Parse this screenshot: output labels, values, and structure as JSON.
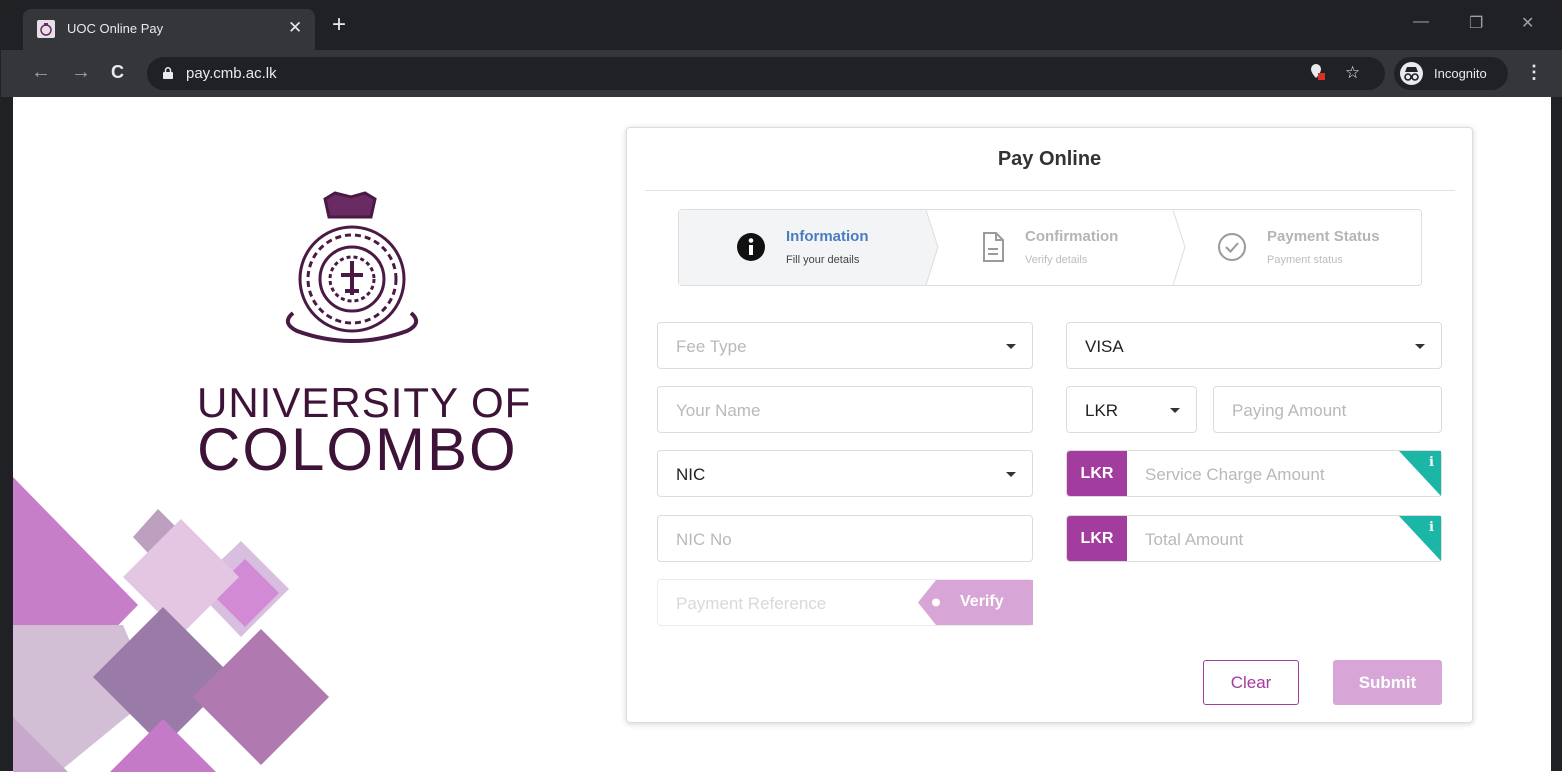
{
  "browser": {
    "tab_title": "UOC Online Pay",
    "tab_close": "✕",
    "new_tab": "+",
    "url": "pay.cmb.ac.lk",
    "incognito_label": "Incognito",
    "win_minimize": "—",
    "win_restore": "❐",
    "win_close": "✕",
    "back": "←",
    "forward": "→",
    "reload": "C",
    "star": "☆",
    "menu": "⋮"
  },
  "brand": {
    "line1": "UNIVERSITY OF",
    "line2": "COLOMBO",
    "color": "#3d1337"
  },
  "card": {
    "title": "Pay Online"
  },
  "steps": [
    {
      "label": "Information",
      "sub": "Fill your details",
      "icon": "info-icon",
      "active": true
    },
    {
      "label": "Confirmation",
      "sub": "Verify details",
      "icon": "document-icon",
      "active": false
    },
    {
      "label": "Payment Status",
      "sub": "Payment status",
      "icon": "check-circle-icon",
      "active": false
    }
  ],
  "form": {
    "fee_type_placeholder": "Fee Type",
    "card_type_value": "VISA",
    "name_placeholder": "Your Name",
    "currency_value": "LKR",
    "paying_amount_placeholder": "Paying Amount",
    "id_type_value": "NIC",
    "service_charge_currency": "LKR",
    "service_charge_placeholder": "Service Charge Amount",
    "nic_placeholder": "NIC No",
    "total_currency": "LKR",
    "total_placeholder": "Total Amount",
    "payment_reference_placeholder": "Payment Reference",
    "verify_label": "Verify",
    "info_glyph": "i"
  },
  "buttons": {
    "clear": "Clear",
    "submit": "Submit"
  },
  "colors": {
    "accent": "#a23c9e",
    "accent_light": "#d7a6d6",
    "info_teal": "#1bb6a6",
    "step_active_text": "#4a7dbf"
  }
}
